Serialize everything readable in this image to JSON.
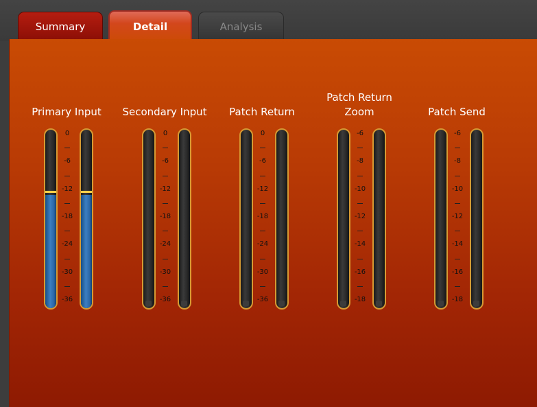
{
  "tabs": [
    {
      "label": "Summary",
      "state": "inactive"
    },
    {
      "label": "Detail",
      "state": "active"
    },
    {
      "label": "Analysis",
      "state": "disabled"
    }
  ],
  "colors": {
    "panel_top": "#c94b04",
    "panel_bottom": "#8e1a02",
    "meter_fill": "#3c7fc2",
    "peak": "#ffd24a"
  },
  "meters": [
    {
      "label": "Primary Input",
      "scale": [
        "0",
        "-6",
        "-12",
        "-18",
        "-24",
        "-30",
        "-36"
      ],
      "range": [
        0,
        -36
      ],
      "channels": [
        {
          "level_db": -13.2,
          "peak_db": -12.8
        },
        {
          "level_db": -13.2,
          "peak_db": -12.8
        }
      ]
    },
    {
      "label": "Secondary Input",
      "scale": [
        "0",
        "-6",
        "-12",
        "-18",
        "-24",
        "-30",
        "-36"
      ],
      "range": [
        0,
        -36
      ],
      "channels": [
        {
          "level_db": null,
          "peak_db": null
        },
        {
          "level_db": null,
          "peak_db": null
        }
      ]
    },
    {
      "label": "Patch Return",
      "scale": [
        "0",
        "-6",
        "-12",
        "-18",
        "-24",
        "-30",
        "-36"
      ],
      "range": [
        0,
        -36
      ],
      "channels": [
        {
          "level_db": null,
          "peak_db": null
        },
        {
          "level_db": null,
          "peak_db": null
        }
      ]
    },
    {
      "label": "Patch Return Zoom",
      "scale": [
        "-6",
        "-8",
        "-10",
        "-12",
        "-14",
        "-16",
        "-18"
      ],
      "range": [
        -6,
        -18
      ],
      "channels": [
        {
          "level_db": null,
          "peak_db": null
        },
        {
          "level_db": null,
          "peak_db": null
        }
      ]
    },
    {
      "label": "Patch Send",
      "scale": [
        "-6",
        "-8",
        "-10",
        "-12",
        "-14",
        "-16",
        "-18"
      ],
      "range": [
        -6,
        -18
      ],
      "channels": [
        {
          "level_db": null,
          "peak_db": null
        },
        {
          "level_db": null,
          "peak_db": null
        }
      ]
    }
  ]
}
